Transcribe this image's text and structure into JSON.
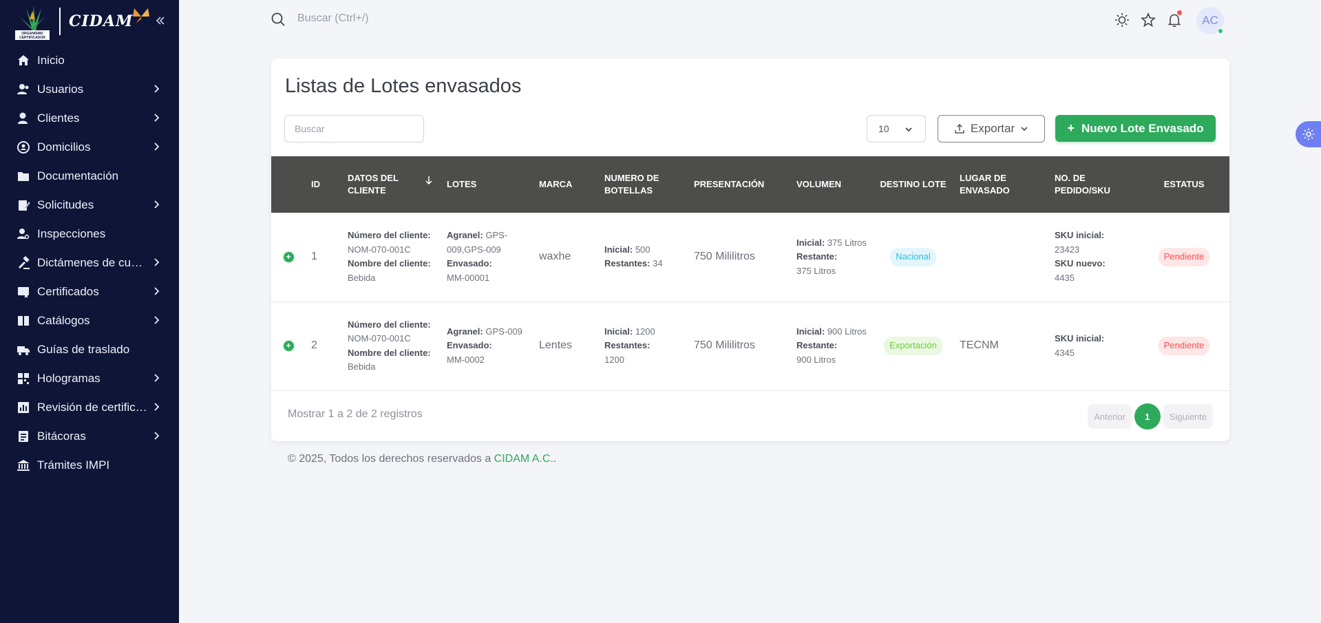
{
  "brand": {
    "seal_text": "ORGANISMO CERTIFICADOR",
    "word": "CIDAM"
  },
  "sidebar": {
    "items": [
      {
        "label": "Inicio",
        "icon": "home-icon",
        "chevron": false
      },
      {
        "label": "Usuarios",
        "icon": "users-icon",
        "chevron": true
      },
      {
        "label": "Clientes",
        "icon": "client-icon",
        "chevron": true
      },
      {
        "label": "Domicilios",
        "icon": "location-icon",
        "chevron": true
      },
      {
        "label": "Documentación",
        "icon": "folder-doc-icon",
        "chevron": false
      },
      {
        "label": "Solicitudes",
        "icon": "edit-doc-icon",
        "chevron": true
      },
      {
        "label": "Inspecciones",
        "icon": "inspector-icon",
        "chevron": false
      },
      {
        "label": "Dictámenes de cumplimiento",
        "icon": "gavel-icon",
        "chevron": true
      },
      {
        "label": "Certificados",
        "icon": "certificate-icon",
        "chevron": true
      },
      {
        "label": "Catálogos",
        "icon": "book-icon",
        "chevron": true
      },
      {
        "label": "Guías de traslado",
        "icon": "truck-icon",
        "chevron": false
      },
      {
        "label": "Hologramas",
        "icon": "qr-icon",
        "chevron": true
      },
      {
        "label": "Revisión de certificados",
        "icon": "chart-doc-icon",
        "chevron": true
      },
      {
        "label": "Bitácoras",
        "icon": "list-icon",
        "chevron": true
      },
      {
        "label": "Trámites IMPI",
        "icon": "bank-icon",
        "chevron": false
      }
    ]
  },
  "topbar": {
    "search_placeholder": "Buscar (Ctrl+/)",
    "avatar_initials": "AC"
  },
  "main": {
    "title": "Listas de Lotes envasados",
    "search_placeholder": "Buscar",
    "page_size": "10",
    "export_label": "Exportar",
    "new_label": "Nuevo Lote Envasado",
    "columns": [
      "ID",
      "DATOS DEL CLIENTE",
      "LOTES",
      "MARCA",
      "NUMERO DE BOTELLAS",
      "PRESENTACIÓN",
      "VOLUMEN",
      "DESTINO LOTE",
      "LUGAR DE ENVASADO",
      "NO. DE PEDIDO/SKU",
      "ESTATUS"
    ],
    "rows": [
      {
        "id": "1",
        "client_num_label": "Número del cliente:",
        "client_num": "NOM-070-001C",
        "client_name_label": "Nombre del cliente:",
        "client_name": "Bebida",
        "agranel_label": "Agranel:",
        "agranel": "GPS-009,GPS-009",
        "envasado_label": "Envasado:",
        "envasado": "MM-00001",
        "marca": "waxhe",
        "inicial_label": "Inicial:",
        "inicial": "500",
        "restantes_label": "Restantes:",
        "restantes": "34",
        "presentacion": "750 Mililitros",
        "vol_inicial_label": "Inicial:",
        "vol_inicial": "375 Litros",
        "vol_restante_label": "Restante:",
        "vol_restante": "375 Litros",
        "destino": "Nacional",
        "lugar": "",
        "sku_inicial_label": "SKU inicial:",
        "sku_inicial": "23423",
        "sku_nuevo_label": "SKU nuevo:",
        "sku_nuevo": "4435",
        "estatus": "Pendiente"
      },
      {
        "id": "2",
        "client_num_label": "Número del cliente:",
        "client_num": "NOM-070-001C",
        "client_name_label": "Nombre del cliente:",
        "client_name": "Bebida",
        "agranel_label": "Agranel:",
        "agranel": "GPS-009",
        "envasado_label": "Envasado:",
        "envasado": "MM-0002",
        "marca": "Lentes",
        "inicial_label": "Inicial:",
        "inicial": "1200",
        "restantes_label": "Restantes:",
        "restantes": "1200",
        "presentacion": "750 Mililitros",
        "vol_inicial_label": "Inicial:",
        "vol_inicial": "900 Litros",
        "vol_restante_label": "Restante:",
        "vol_restante": "900 Litros",
        "destino": "Exportación",
        "lugar": "TECNM",
        "sku_inicial_label": "SKU inicial:",
        "sku_inicial": "4345",
        "estatus": "Pendiente"
      }
    ],
    "info": "Mostrar 1 a 2 de 2 registros",
    "pager": {
      "prev": "Anterior",
      "page": "1",
      "next": "Siguiente"
    }
  },
  "footer": {
    "text": "© 2025, Todos los derechos reservados a ",
    "link": "CIDAM A.C.",
    "suffix": "."
  },
  "colors": {
    "sidebar_bg": "#0e1537",
    "primary_green": "#2eaa5c",
    "table_header": "#4d4d4b",
    "danger": "#ff4c51",
    "info": "#2fbde0",
    "success_light": "#6bcf37"
  }
}
